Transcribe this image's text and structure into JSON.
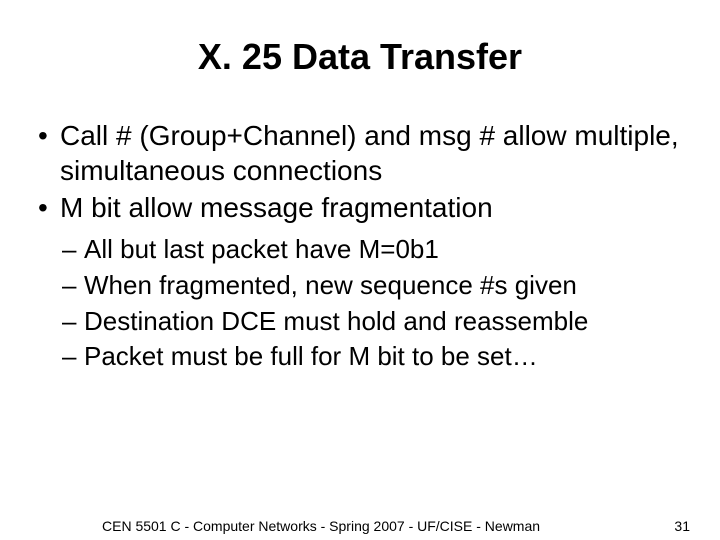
{
  "title": "X. 25 Data Transfer",
  "bullets": [
    "Call # (Group+Channel) and msg # allow multiple, simultaneous connections",
    "M bit allow message fragmentation"
  ],
  "sub_bullets": [
    "All but last packet have M=0b1",
    "When fragmented, new sequence #s given",
    "Destination DCE must hold and reassemble",
    "Packet must be full for M bit to be set…"
  ],
  "footer": {
    "text": "CEN 5501 C - Computer Networks - Spring 2007 - UF/CISE - Newman",
    "page": "31"
  }
}
